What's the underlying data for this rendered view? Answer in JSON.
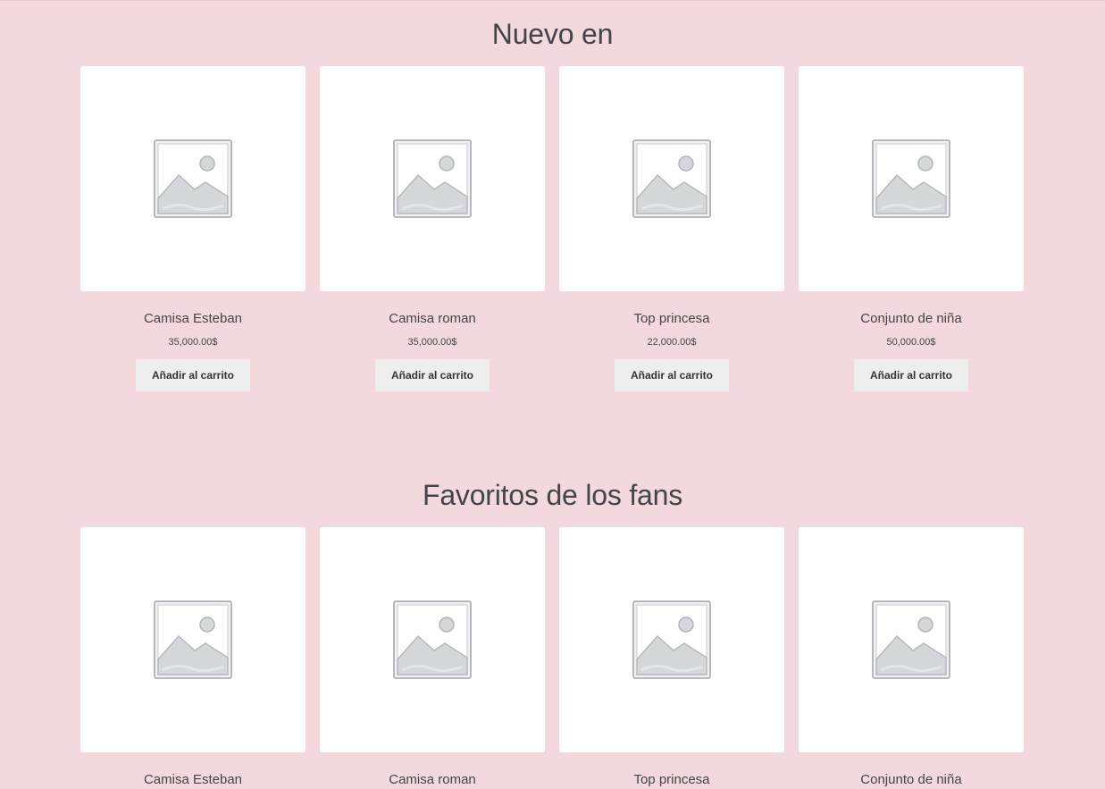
{
  "sections": [
    {
      "title": "Nuevo en",
      "products": [
        {
          "name": "Camisa Esteban",
          "price": "35,000.00$",
          "button": "Añadir al carrito",
          "image_icon": "placeholder-image-icon"
        },
        {
          "name": "Camisa roman",
          "price": "35,000.00$",
          "button": "Añadir al carrito",
          "image_icon": "placeholder-image-icon"
        },
        {
          "name": "Top princesa",
          "price": "22,000.00$",
          "button": "Añadir al carrito",
          "image_icon": "placeholder-image-icon"
        },
        {
          "name": "Conjunto de niña",
          "price": "50,000.00$",
          "button": "Añadir al carrito",
          "image_icon": "placeholder-image-icon"
        }
      ]
    },
    {
      "title": "Favoritos de los fans",
      "products": [
        {
          "name": "Camisa Esteban",
          "image_icon": "placeholder-image-icon"
        },
        {
          "name": "Camisa roman",
          "image_icon": "placeholder-image-icon"
        },
        {
          "name": "Top princesa",
          "image_icon": "placeholder-image-icon"
        },
        {
          "name": "Conjunto de niña",
          "image_icon": "placeholder-image-icon"
        }
      ]
    }
  ],
  "colors": {
    "page_background": "#f3d9dd",
    "card_background": "#ffffff",
    "button_background": "#eeeeee",
    "text": "#43454b"
  }
}
